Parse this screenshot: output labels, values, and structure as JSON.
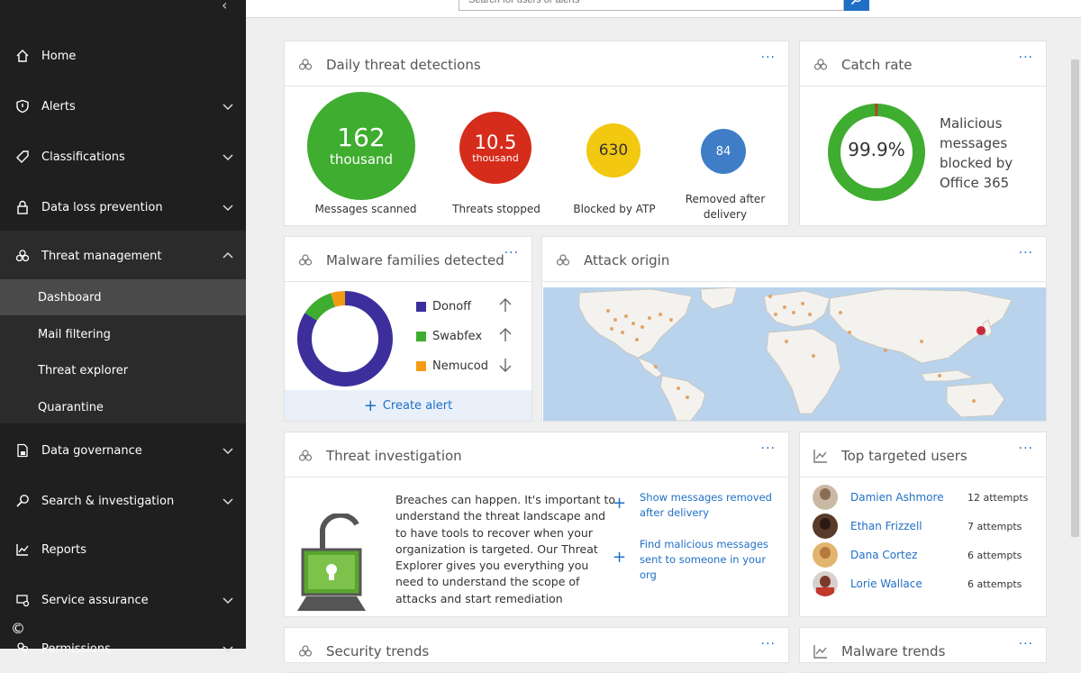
{
  "search": {
    "placeholder": "Search for users or alerts"
  },
  "sidebar": {
    "items": [
      {
        "label": "Home",
        "icon": "home-icon"
      },
      {
        "label": "Alerts",
        "icon": "shield-icon"
      },
      {
        "label": "Classifications",
        "icon": "tag-icon"
      },
      {
        "label": "Data loss prevention",
        "icon": "lock-icon"
      },
      {
        "label": "Threat management",
        "icon": "biohazard-icon"
      },
      {
        "label": "Data governance",
        "icon": "document-lock-icon"
      },
      {
        "label": "Search & investigation",
        "icon": "search-icon"
      },
      {
        "label": "Reports",
        "icon": "chart-icon"
      },
      {
        "label": "Service assurance",
        "icon": "service-icon"
      },
      {
        "label": "Permissions",
        "icon": "people-icon"
      }
    ],
    "sub_items": [
      "Dashboard",
      "Mail filtering",
      "Threat explorer",
      "Quarantine"
    ],
    "active_sub": "Dashboard",
    "copyright": "©"
  },
  "cards": {
    "daily": {
      "title": "Daily threat detections",
      "stats": [
        {
          "value": "162",
          "unit": "thousand",
          "label": "Messages scanned",
          "color": "#3fad2f"
        },
        {
          "value": "10.5",
          "unit": "thousand",
          "label": "Threats stopped",
          "color": "#d62c1b"
        },
        {
          "value": "630",
          "label": "Blocked by ATP",
          "color": "#f2c811"
        },
        {
          "value": "84",
          "label_line1": "Removed after",
          "label_line2": "delivery",
          "color": "#3f7ec7"
        }
      ]
    },
    "catch": {
      "title": "Catch rate",
      "rate": "99.9%",
      "rate_value": 99.9,
      "desc": [
        "Malicious",
        "messages",
        "blocked by",
        "Office 365"
      ]
    },
    "malware": {
      "title": "Malware families detected",
      "families": [
        {
          "name": "Donoff",
          "color": "#3c2f9c",
          "trend": "up",
          "share": 0.84
        },
        {
          "name": "Swabfex",
          "color": "#3fad2f",
          "trend": "up",
          "share": 0.11
        },
        {
          "name": "Nemucod",
          "color": "#f39c12",
          "trend": "down",
          "share": 0.05
        }
      ],
      "create_alert": "Create alert"
    },
    "attack": {
      "title": "Attack origin"
    },
    "investigation": {
      "title": "Threat investigation",
      "text": [
        "Breaches can happen. It's important to",
        "understand the threat landscape and",
        "to have tools to recover when your",
        "organization is targeted. Our Threat",
        "Explorer gives you everything you",
        "need to understand the scope of",
        "attacks and start remediation"
      ],
      "links": [
        [
          "Show messages removed",
          "after delivery"
        ],
        [
          "Find malicious messages",
          "sent to someone in your",
          "org"
        ]
      ]
    },
    "targeted": {
      "title": "Top targeted users",
      "users": [
        {
          "name": "Damien Ashmore",
          "attempts": "12 attempts"
        },
        {
          "name": "Ethan Frizzell",
          "attempts": "7 attempts"
        },
        {
          "name": "Dana Cortez",
          "attempts": "6 attempts"
        },
        {
          "name": "Lorie Wallace",
          "attempts": "6 attempts"
        }
      ]
    },
    "security": {
      "title": "Security trends"
    },
    "malware_trends": {
      "title": "Malware trends"
    },
    "more_label": "···"
  }
}
